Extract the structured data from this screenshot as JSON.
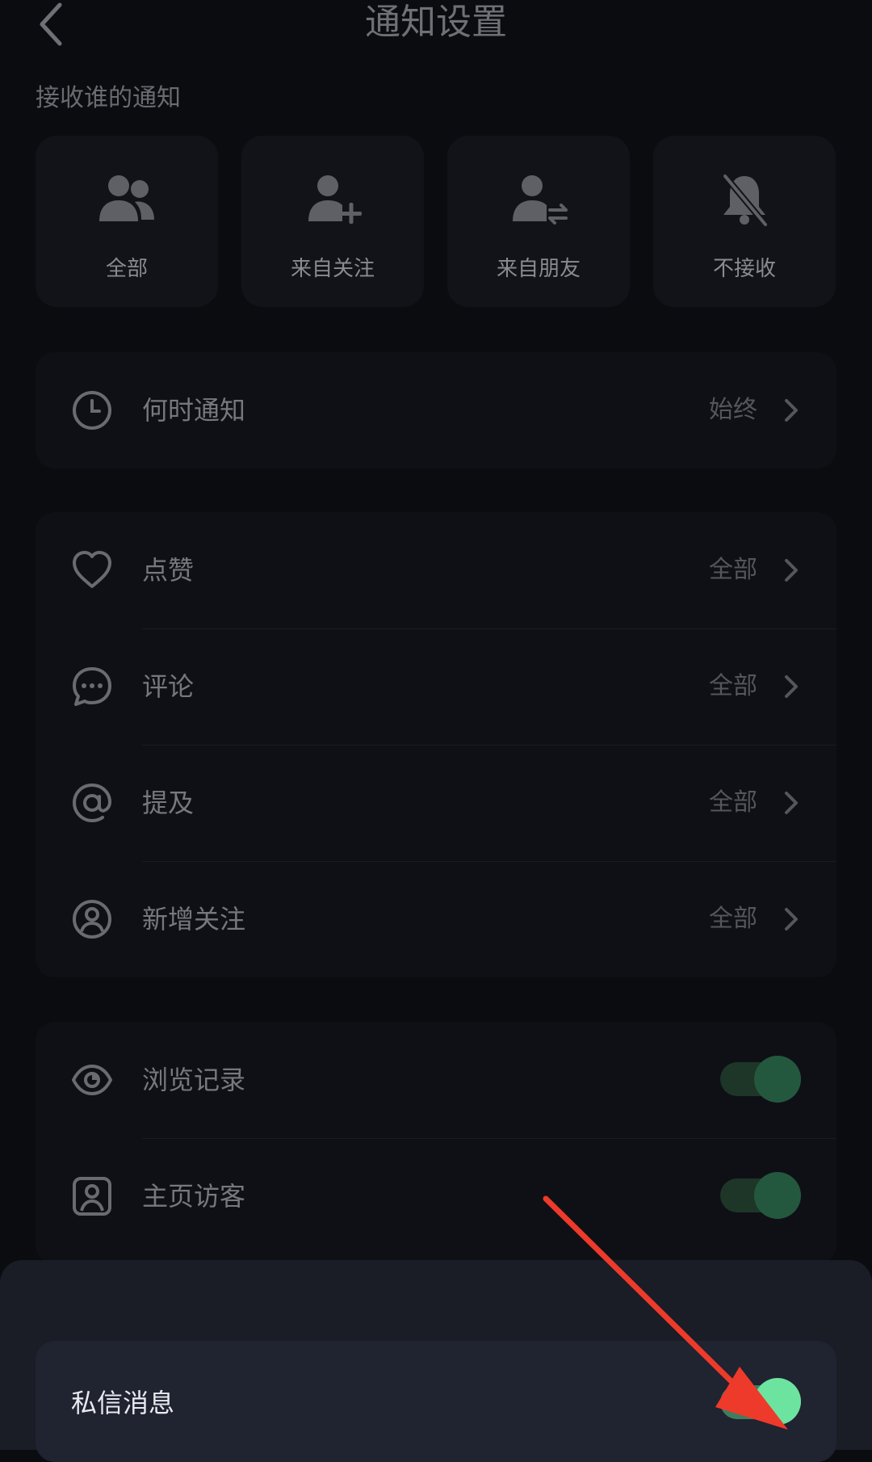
{
  "header": {
    "title": "通知设置"
  },
  "who_section": {
    "label": "接收谁的通知",
    "options": [
      {
        "label": "全部",
        "icon": "group-icon"
      },
      {
        "label": "来自关注",
        "icon": "user-add-icon"
      },
      {
        "label": "来自朋友",
        "icon": "user-exchange-icon"
      },
      {
        "label": "不接收",
        "icon": "bell-off-icon"
      }
    ]
  },
  "when_group": {
    "label": "何时通知",
    "value": "始终",
    "icon": "clock-icon"
  },
  "types_group": {
    "items": [
      {
        "label": "点赞",
        "value": "全部",
        "icon": "heart-icon"
      },
      {
        "label": "评论",
        "value": "全部",
        "icon": "comment-icon"
      },
      {
        "label": "提及",
        "value": "全部",
        "icon": "at-icon"
      },
      {
        "label": "新增关注",
        "value": "全部",
        "icon": "user-circle-icon"
      }
    ]
  },
  "toggle_group": {
    "items": [
      {
        "label": "浏览记录",
        "icon": "eye-icon",
        "on": true
      },
      {
        "label": "主页访客",
        "icon": "visitor-icon",
        "on": true
      }
    ]
  },
  "sheet": {
    "label": "私信消息",
    "on": true
  },
  "colors": {
    "background": "#0b0c10",
    "toggle_on_knob": "#6de3a0",
    "arrow": "#ee3a2a"
  }
}
